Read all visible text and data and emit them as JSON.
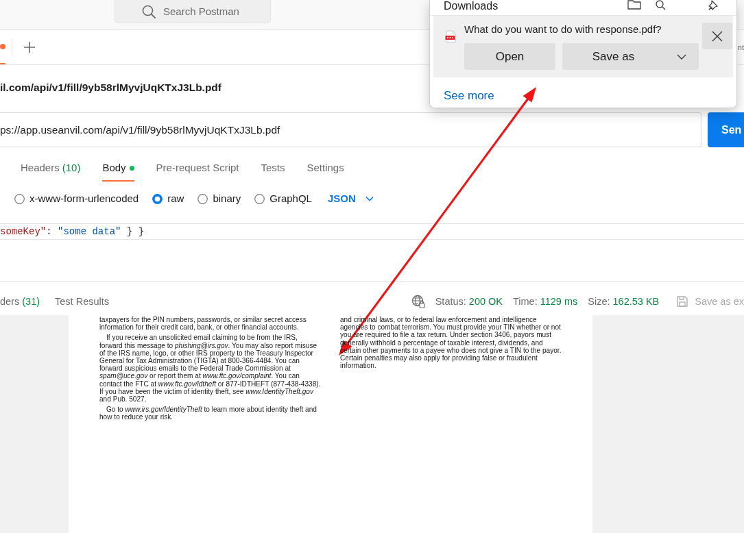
{
  "top_bar": {
    "search": {
      "placeholder": "Search Postman"
    }
  },
  "tab_bar": {
    "tabs": [
      {
        "selected": true,
        "unsaved": true
      }
    ],
    "partial_label": "nt"
  },
  "request": {
    "title": "il.com/api/v1/fill/9yb58rlMyvjUqKTxJ3Lb.pdf",
    "url": "ps://app.useanvil.com/api/v1/fill/9yb58rlMyvjUqKTxJ3Lb.pdf",
    "send_button": "Sen",
    "tabs": [
      {
        "label": "Headers",
        "count": "(10)",
        "indicator": false,
        "selected": false
      },
      {
        "label": "Body",
        "indicator": true,
        "selected": true
      },
      {
        "label": "Pre-request Script",
        "indicator": false,
        "selected": false
      },
      {
        "label": "Tests",
        "indicator": false,
        "selected": false
      },
      {
        "label": "Settings",
        "indicator": false,
        "selected": false
      }
    ],
    "body_types": [
      {
        "label": "x-www-form-urlencoded",
        "selected": false
      },
      {
        "label": "raw",
        "selected": true
      },
      {
        "label": "binary",
        "selected": false
      },
      {
        "label": "GraphQL",
        "selected": false
      }
    ],
    "format": "JSON",
    "editor_line": [
      {
        "kind": "key",
        "text": "someKey\""
      },
      {
        "kind": "colon",
        "text": ":"
      },
      {
        "kind": "string",
        "text": "\"some data\""
      },
      {
        "kind": "brace",
        "text": "}"
      },
      {
        "kind": "brace",
        "text": "}"
      }
    ]
  },
  "response": {
    "tabs": [
      {
        "label": "ders",
        "count": "(31)",
        "selected": false
      },
      {
        "label": "Test Results",
        "selected": false
      }
    ],
    "status": [
      {
        "label": "Status:",
        "value": "200 OK"
      },
      {
        "label": "Time:",
        "value": "1129 ms"
      },
      {
        "label": "Size:",
        "value": "162.53 KB"
      }
    ],
    "save_button": "Save as ex",
    "document": {
      "columns": [
        {
          "paragraphs": [
            {
              "text": "taxpayers for the PIN numbers, passwords, or similar secret access information for their credit card, bank, or other financial accounts.",
              "indented": false
            },
            {
              "text": "If you receive an unsolicited email claiming to be from the IRS, forward this message to *phishing@irs.gov*. You may also report misuse of the IRS name, logo, or other IRS property to the Treasury Inspector General for Tax Administration (TIGTA) at 800-366-4484. You can forward suspicious emails to the Federal Trade Commission at *spam@uce.gov* or report them at *www.ftc.gov/complaint*. You can contact the FTC at *www.ftc.gov/idtheft* or 877-IDTHEFT (877-438-4338). If you have been the victim of identity theft, see *www.IdentityTheft.gov* and Pub. 5027.",
              "indented": true
            },
            {
              "text": "Go to *www.irs.gov/IdentityTheft* to learn more about identity theft and how to reduce your risk.",
              "indented": true
            }
          ]
        },
        {
          "paragraphs": [
            {
              "text": "and criminal laws, or to federal law enforcement and intelligence agencies to combat terrorism. You must provide your TIN whether or not you are required to file a tax return. Under section 3406, payors must generally withhold a percentage of taxable interest, dividends, and certain other payments to a payee who does not give a TIN to the payor. Certain penalties may also apply for providing false or fraudulent information.",
              "indented": false
            }
          ]
        }
      ]
    }
  },
  "downloads": {
    "title": "Downloads",
    "prompt": "What do you want to do with response.pdf?",
    "buttons": [
      {
        "label": "Open",
        "kind": "plain"
      },
      {
        "label": "Save as",
        "kind": "split"
      }
    ],
    "link": "See more"
  }
}
